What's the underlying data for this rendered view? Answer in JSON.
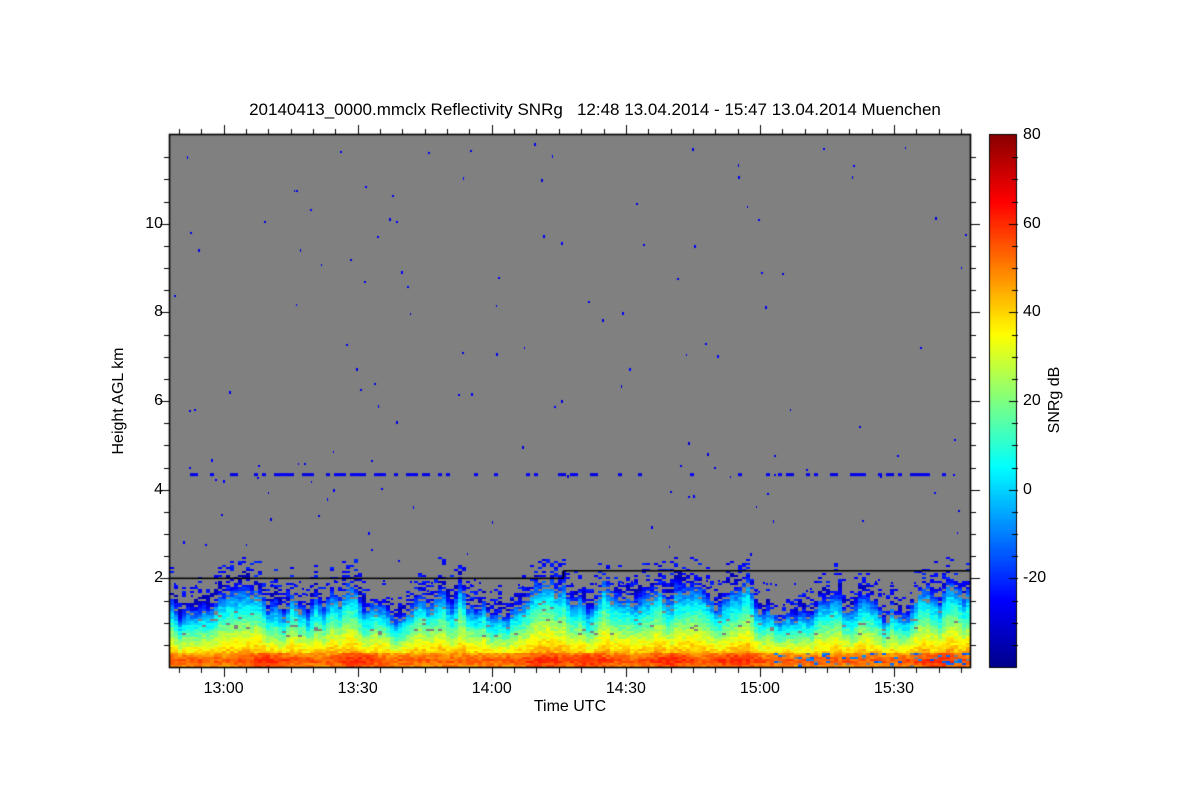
{
  "chart_data": {
    "type": "heatmap",
    "title": "20140413_0000.mmclx Reflectivity SNRg   12:48 13.04.2014 - 15:47 13.04.2014 Muenchen",
    "file": "20140413_0000.mmclx",
    "quantity": "Reflectivity SNRg",
    "time_start": "12:48 13.04.2014",
    "time_end": "15:47 13.04.2014",
    "station": "Muenchen",
    "xlabel": "Time UTC",
    "ylabel": "Height AGL km",
    "x_range": [
      "12:48",
      "15:47"
    ],
    "x_ticks": [
      "13:00",
      "13:30",
      "14:00",
      "14:30",
      "15:00",
      "15:30"
    ],
    "x_minor_step_min": 5,
    "y_range_km": [
      0,
      12
    ],
    "y_ticks_km": [
      2,
      4,
      6,
      8,
      10
    ],
    "y_minor_step_km": 0.5,
    "colorbar": {
      "label": "SNRg dB",
      "range_db": [
        -40,
        80
      ],
      "ticks_db": [
        80,
        60,
        40,
        20,
        0,
        -20
      ],
      "minor_step_db": 5,
      "colormap": "jet",
      "jet_stops": [
        [
          0.0,
          "#00008b"
        ],
        [
          0.125,
          "#0000ff"
        ],
        [
          0.375,
          "#00ffff"
        ],
        [
          0.625,
          "#ffff00"
        ],
        [
          0.875,
          "#ff0000"
        ],
        [
          1.0,
          "#8b0000"
        ]
      ]
    },
    "no_signal_color": "#808080",
    "frame_color": "#000000",
    "speckle_db": -27,
    "upper_speckle_count": 120,
    "interference_line": {
      "height_km": 4.35,
      "coverage": 0.3,
      "db": -25
    },
    "sensitivity_step_line": {
      "color": "#000000",
      "left_height_km": 2.0,
      "right_height_km": 2.17,
      "step_time": "14:16"
    },
    "boundary_layer_top_km": {
      "start": "12:48",
      "step_min": 5,
      "values": [
        1.75,
        1.45,
        1.65,
        1.95,
        1.85,
        1.55,
        1.8,
        1.7,
        2.1,
        1.7,
        1.5,
        1.75,
        2.0,
        1.9,
        1.55,
        1.45,
        1.8,
        2.25,
        1.95,
        1.85,
        2.1,
        1.8,
        1.95,
        2.1,
        1.7,
        1.9,
        2.0,
        1.4,
        1.25,
        1.55,
        1.9,
        1.7,
        1.45,
        1.5,
        1.85,
        2.0,
        1.9
      ]
    },
    "ground_band": {
      "top_km": 0.33,
      "peak_db": 55,
      "hotspots_utc": [
        "13:10",
        "13:30",
        "14:12",
        "14:22",
        "14:40",
        "14:55",
        "15:40"
      ],
      "patchy_after_utc": "15:03"
    },
    "surface_db_near_ground": 55,
    "render_seed": 20140413
  }
}
